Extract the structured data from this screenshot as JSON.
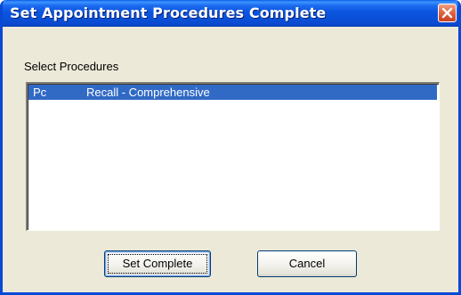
{
  "window": {
    "title": "Set Appointment Procedures Complete"
  },
  "group": {
    "label": "Select Procedures"
  },
  "procedures": [
    {
      "code": "Pc",
      "description": "Recall - Comprehensive",
      "selected": true
    }
  ],
  "buttons": {
    "set_complete": "Set Complete",
    "cancel": "Cancel"
  },
  "colors": {
    "titlebar": "#0a55e0",
    "selection": "#316ac5",
    "dialog_bg": "#ece9d8",
    "close_button": "#e36b49"
  },
  "icons": {
    "close": "close-icon"
  }
}
